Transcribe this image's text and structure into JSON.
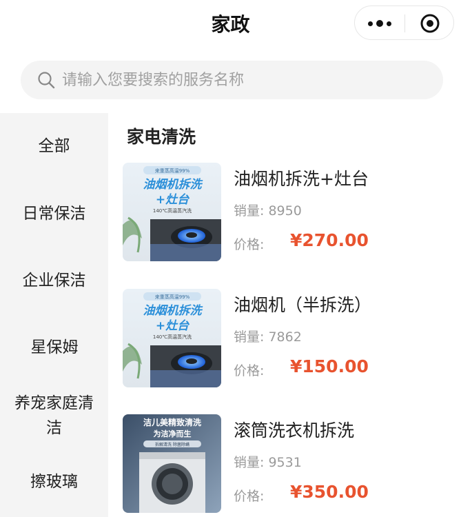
{
  "header": {
    "title": "家政"
  },
  "search": {
    "placeholder": "请输入您要搜索的服务名称"
  },
  "sidebar": {
    "items": [
      {
        "label": "全部"
      },
      {
        "label": "日常保洁"
      },
      {
        "label": "企业保洁"
      },
      {
        "label": "星保姆"
      },
      {
        "label": "养宠家庭清洁"
      },
      {
        "label": "擦玻璃"
      }
    ]
  },
  "main": {
    "section_title": "家电清洗",
    "products": [
      {
        "name": "油烟机拆洗+灶台",
        "sales": "销量: 8950",
        "price_label": "价格:",
        "price": "¥270.00",
        "image_text": {
          "tag": "来重蒸高温99%",
          "line1": "油烟机拆洗",
          "line2": "+灶台",
          "line3": "140℃高温蒸汽洗"
        }
      },
      {
        "name": "油烟机（半拆洗）",
        "sales": "销量: 7862",
        "price_label": "价格:",
        "price": "¥150.00",
        "image_text": {
          "tag": "来重蒸高温99%",
          "line1": "油烟机拆洗",
          "line2": "+灶台",
          "line3": "140℃高温蒸汽洗"
        }
      },
      {
        "name": "滚筒洗衣机拆洗",
        "sales": "销量: 9531",
        "price_label": "价格:",
        "price": "¥350.00",
        "image_text": {
          "line1": "洁儿美精致清洗",
          "line2": "为洁净而生",
          "line3": "拆解清洗 除菌除螨"
        }
      }
    ]
  },
  "colors": {
    "price": "#e8532f",
    "sidebar_bg": "#f4f4f4",
    "search_bg": "#f4f4f4"
  }
}
